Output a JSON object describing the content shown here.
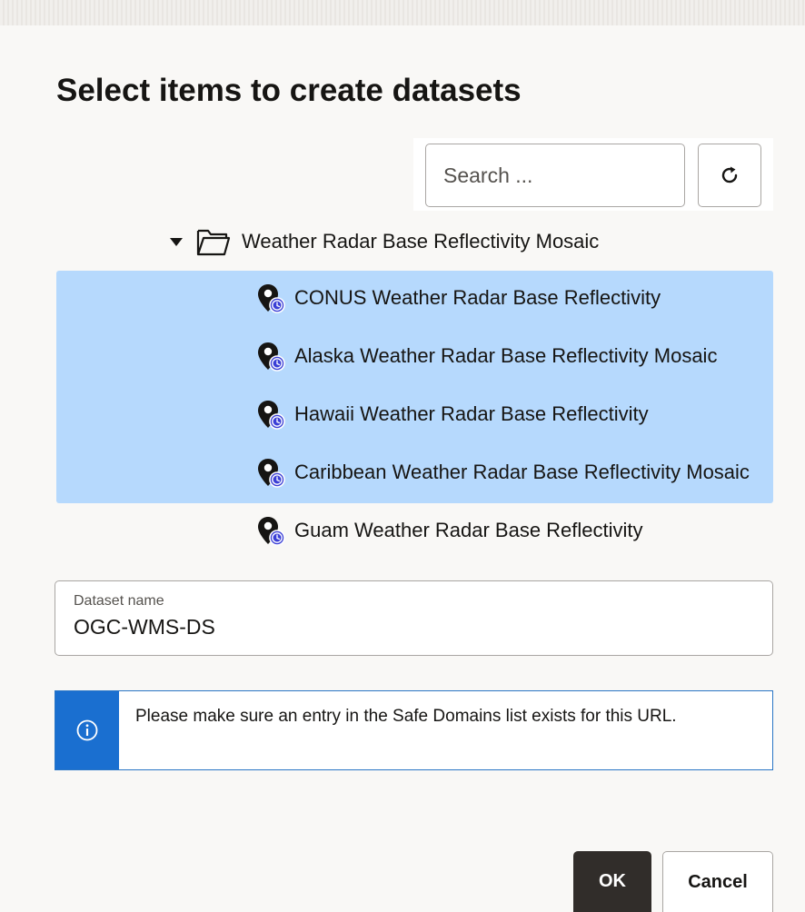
{
  "dialog": {
    "title": "Select items to create datasets"
  },
  "search": {
    "placeholder": "Search ..."
  },
  "icons": {
    "refresh": "refresh-icon",
    "caret": "caret-down-icon",
    "folder": "folder-open-icon",
    "layer": "map-pin-clock-icon",
    "info": "info-icon"
  },
  "tree": {
    "folder_label": "Weather Radar Base Reflectivity Mosaic",
    "items": [
      {
        "label": "CONUS Weather Radar Base Reflectivity",
        "selected": true
      },
      {
        "label": "Alaska Weather Radar Base Reflectivity Mosaic",
        "selected": true
      },
      {
        "label": "Hawaii Weather Radar Base Reflectivity",
        "selected": true
      },
      {
        "label": "Caribbean Weather Radar Base Reflectivity Mosaic",
        "selected": true
      },
      {
        "label": "Guam Weather Radar Base Reflectivity",
        "selected": false
      }
    ]
  },
  "dataset_name": {
    "label": "Dataset name",
    "value": "OGC-WMS-DS"
  },
  "info_banner": {
    "message": "Please make sure an entry in the Safe Domains list exists for this URL."
  },
  "buttons": {
    "ok": "OK",
    "cancel": "Cancel"
  },
  "colors": {
    "selection": "#b6d9fd",
    "info_blue": "#1a6fd0",
    "primary_button": "#312d2a",
    "clock_badge": "#3b3fd6"
  }
}
